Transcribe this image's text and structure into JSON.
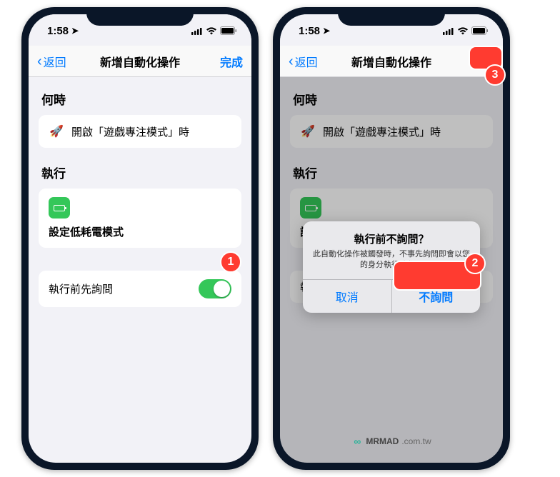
{
  "statusBar": {
    "time": "1:58",
    "locationGlyph": "➤"
  },
  "nav": {
    "back": "返回",
    "title": "新增自動化操作",
    "done": "完成"
  },
  "sections": {
    "when": "何時",
    "do": "執行"
  },
  "whenCard": {
    "text": "開啟「遊戲專注模式」時"
  },
  "doCard": {
    "text": "設定低耗電模式"
  },
  "toggle": {
    "label": "執行前先詢問",
    "labelShort": "執行"
  },
  "alert": {
    "title": "執行前不詢問？",
    "message": "此自動化操作被觸發時，不事先詢問即會以您的身分執行動作。",
    "cancel": "取消",
    "confirm": "不詢問"
  },
  "badges": {
    "one": "1",
    "two": "2",
    "three": "3"
  },
  "watermark": {
    "brand": "MRMAD",
    "domain": ".com.tw"
  }
}
